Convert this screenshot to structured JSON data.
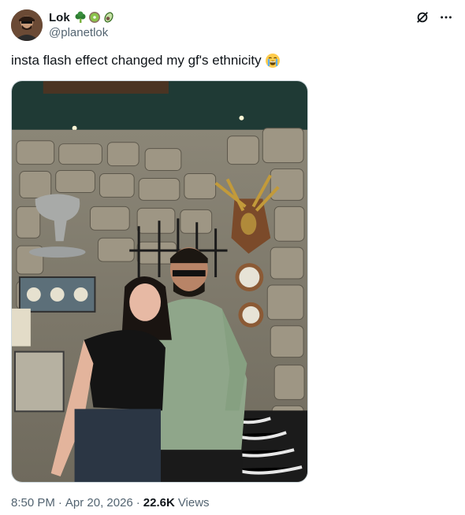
{
  "author": {
    "display_name": "Lok",
    "handle": "@planetlok",
    "badge_emojis": [
      "broccoli",
      "kiwi",
      "avocado"
    ]
  },
  "tweet": {
    "text": "insta flash effect changed my gf's ethnicity",
    "trailing_emoji": "loudly-crying-face"
  },
  "meta": {
    "time": "8:50 PM",
    "date": "Apr 20, 2026",
    "separator": "·",
    "views_count": "22.6K",
    "views_label": "Views"
  },
  "icons": {
    "grok": "grok-icon",
    "more": "more-icon"
  },
  "colors": {
    "text_primary": "#0f1419",
    "text_secondary": "#536471",
    "border": "#cfd9de"
  }
}
